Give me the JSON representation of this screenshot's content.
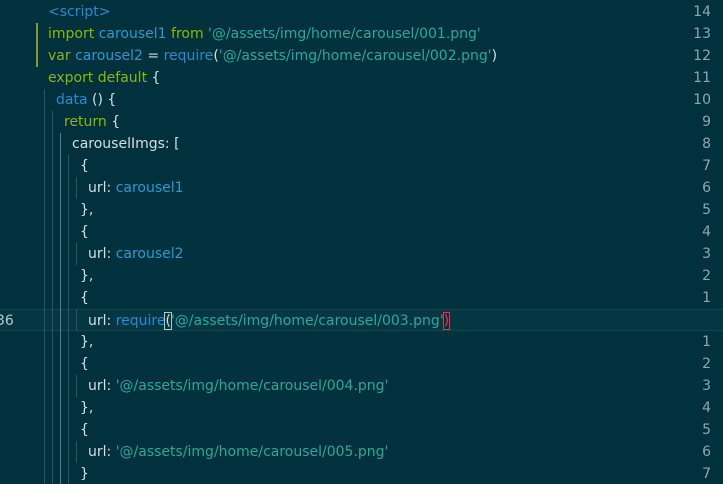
{
  "editor": {
    "lines": [
      {
        "number": "14",
        "tokens": [
          {
            "t": "<script>",
            "c": "tag"
          }
        ]
      },
      {
        "number": "13",
        "tokens": [
          {
            "t": "import ",
            "c": "kw"
          },
          {
            "t": "carousel1",
            "c": "var"
          },
          {
            "t": " from ",
            "c": "kw"
          },
          {
            "t": "'@/assets/img/home/carousel/001.png'",
            "c": "str"
          }
        ]
      },
      {
        "number": "12",
        "tokens": [
          {
            "t": "var ",
            "c": "kw"
          },
          {
            "t": "carousel2",
            "c": "var"
          },
          {
            "t": " = ",
            "c": "plain"
          },
          {
            "t": "require",
            "c": "fn"
          },
          {
            "t": "(",
            "c": "plain"
          },
          {
            "t": "'@/assets/img/home/carousel/002.png'",
            "c": "str"
          },
          {
            "t": ")",
            "c": "plain"
          }
        ]
      },
      {
        "number": "11",
        "tokens": [
          {
            "t": "export default ",
            "c": "kw"
          },
          {
            "t": "{",
            "c": "plain"
          }
        ]
      },
      {
        "number": "10",
        "tokens": [
          {
            "t": "data ",
            "c": "fn"
          },
          {
            "t": "() {",
            "c": "plain"
          }
        ]
      },
      {
        "number": "9",
        "tokens": [
          {
            "t": "return ",
            "c": "kw"
          },
          {
            "t": "{",
            "c": "plain"
          }
        ]
      },
      {
        "number": "8",
        "tokens": [
          {
            "t": "carouselImgs: [",
            "c": "plain"
          }
        ]
      },
      {
        "number": "7",
        "tokens": [
          {
            "t": "{",
            "c": "plain"
          }
        ]
      },
      {
        "number": "6",
        "tokens": [
          {
            "t": "url: ",
            "c": "plain"
          },
          {
            "t": "carousel1",
            "c": "var"
          }
        ]
      },
      {
        "number": "5",
        "tokens": [
          {
            "t": "},",
            "c": "plain"
          }
        ]
      },
      {
        "number": "4",
        "tokens": [
          {
            "t": "{",
            "c": "plain"
          }
        ]
      },
      {
        "number": "3",
        "tokens": [
          {
            "t": "url: ",
            "c": "plain"
          },
          {
            "t": "carousel2",
            "c": "var"
          }
        ]
      },
      {
        "number": "2",
        "tokens": [
          {
            "t": "},",
            "c": "plain"
          }
        ]
      },
      {
        "number": "1",
        "tokens": [
          {
            "t": "{",
            "c": "plain"
          }
        ]
      },
      {
        "number": "36",
        "tokens": [
          {
            "t": "url: ",
            "c": "plain"
          },
          {
            "t": "require",
            "c": "fn"
          },
          {
            "t": "(",
            "c": "match"
          },
          {
            "t": "'@/assets/img/home/carousel/003.png'",
            "c": "str"
          },
          {
            "t": ")",
            "c": "error"
          }
        ]
      },
      {
        "number": "1",
        "tokens": [
          {
            "t": "},",
            "c": "plain"
          }
        ]
      },
      {
        "number": "2",
        "tokens": [
          {
            "t": "{",
            "c": "plain"
          }
        ]
      },
      {
        "number": "3",
        "tokens": [
          {
            "t": "url: ",
            "c": "plain"
          },
          {
            "t": "'@/assets/img/home/carousel/004.png'",
            "c": "str"
          }
        ]
      },
      {
        "number": "4",
        "tokens": [
          {
            "t": "},",
            "c": "plain"
          }
        ]
      },
      {
        "number": "5",
        "tokens": [
          {
            "t": "{",
            "c": "plain"
          }
        ]
      },
      {
        "number": "6",
        "tokens": [
          {
            "t": "url: ",
            "c": "plain"
          },
          {
            "t": "'@/assets/img/home/carousel/005.png'",
            "c": "str"
          }
        ]
      },
      {
        "number": "7",
        "tokens": [
          {
            "t": "}",
            "c": "plain"
          }
        ]
      }
    ],
    "current_line_index": 14,
    "colors": {
      "background": "#00313c",
      "keyword": "#8fb60d",
      "variable": "#269ad6",
      "string": "#2ba898",
      "text": "#d6dfe0",
      "error_bracket": "#e2364c"
    }
  }
}
